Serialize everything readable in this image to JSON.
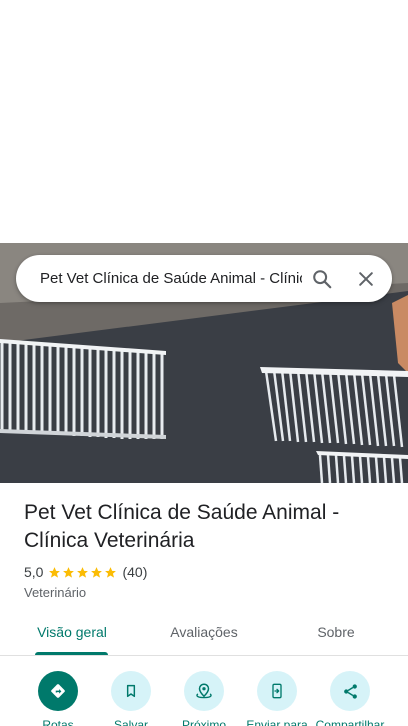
{
  "search": {
    "query": "Pet Vet Clínica de Saúde Animal - Clínica Veterinária",
    "search_icon": "search-icon",
    "close_icon": "close-icon"
  },
  "place": {
    "title": "Pet Vet Clínica de Saúde Animal - Clínica Veterinária",
    "rating": "5,0",
    "stars": 5,
    "review_count": "(40)",
    "category": "Veterinário"
  },
  "tabs": [
    {
      "label": "Visão geral",
      "active": true
    },
    {
      "label": "Avaliações",
      "active": false
    },
    {
      "label": "Sobre",
      "active": false
    }
  ],
  "actions": [
    {
      "label": "Rotas",
      "icon": "directions-icon"
    },
    {
      "label": "Salvar",
      "icon": "bookmark-icon"
    },
    {
      "label": "Próximo",
      "icon": "nearby-icon"
    },
    {
      "label": "Enviar para",
      "icon": "send-to-phone-icon"
    },
    {
      "label": "Compartilhar",
      "icon": "share-icon"
    }
  ],
  "colors": {
    "accent": "#00796b",
    "action_bg": "#d6f3f8",
    "star": "#fbbc04"
  }
}
